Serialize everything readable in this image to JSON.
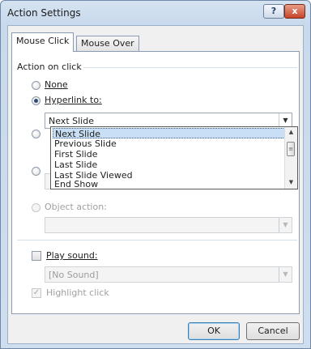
{
  "window": {
    "title": "Action Settings",
    "help_glyph": "?",
    "close_glyph": "x"
  },
  "tabs": [
    {
      "label": "Mouse Click",
      "active": true
    },
    {
      "label": "Mouse Over",
      "active": false
    }
  ],
  "action_group": {
    "label": "Action on click",
    "options": {
      "none": {
        "label": "None",
        "checked": false
      },
      "hyperlink": {
        "label": "Hyperlink to:",
        "checked": true
      },
      "object_action": {
        "label": "Object action:",
        "checked": false,
        "enabled": false
      }
    },
    "hyperlink_selected": "Next Slide",
    "hyperlink_dropdown": [
      "Next Slide",
      "Previous Slide",
      "First Slide",
      "Last Slide",
      "Last Slide Viewed",
      "End Show"
    ],
    "object_action_value": ""
  },
  "sound": {
    "play_sound_label": "Play sound:",
    "play_sound_checked": false,
    "sound_value": "[No Sound]",
    "highlight_click_label": "Highlight click",
    "highlight_click_checked": true,
    "highlight_click_enabled": false
  },
  "buttons": {
    "ok": "OK",
    "cancel": "Cancel"
  },
  "icons": {
    "combo_arrow": "▼",
    "scroll_up": "▲",
    "scroll_down": "▼",
    "scroll_grip": "≡",
    "check_mark": "✓"
  }
}
